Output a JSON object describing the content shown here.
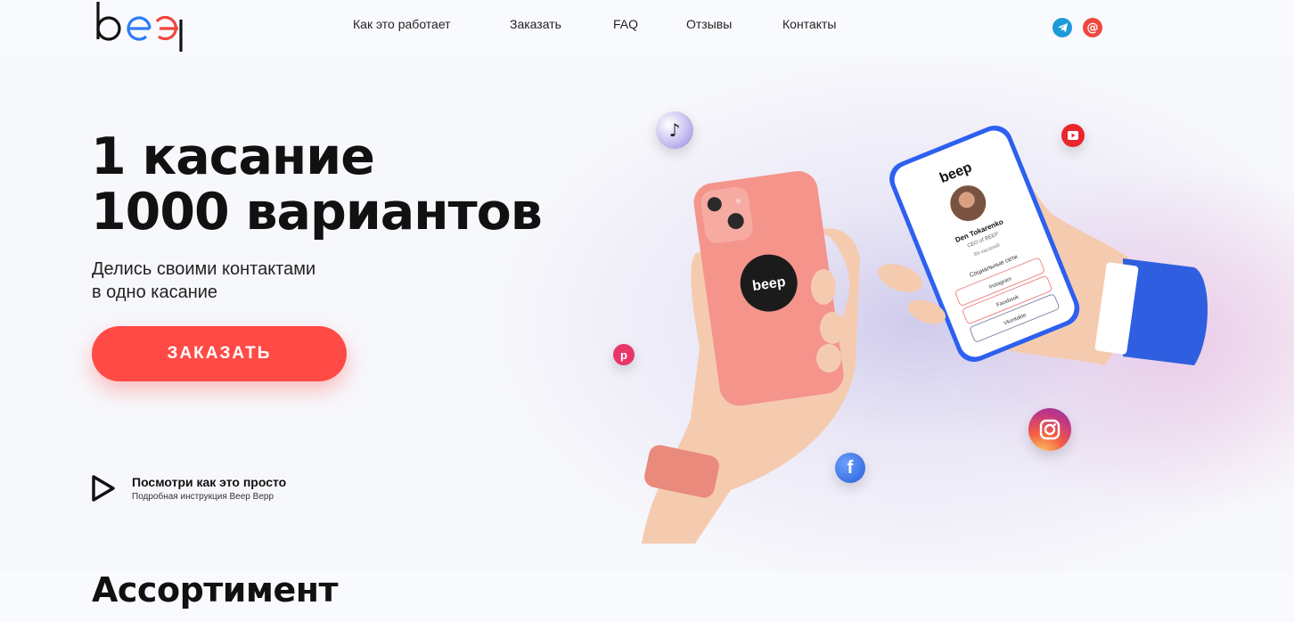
{
  "header": {
    "logo_text": "beep",
    "nav": [
      "Как это работает",
      "Заказать",
      "FAQ",
      "Отзывы",
      "Контакты"
    ],
    "social": [
      "telegram-icon",
      "email-icon"
    ]
  },
  "hero": {
    "title_line1": "1 касание",
    "title_line2": "1000 вариантов",
    "subtitle_line1": "Делись своими контактами",
    "subtitle_line2": "в одно касание",
    "order_button": "ЗАКАЗАТЬ",
    "video_title": "Посмотри как это просто",
    "video_subtitle": "Подробная инструкция Beep Bepp"
  },
  "phone_card": {
    "name": "Den Tokarenko",
    "role": "CEO of BEEP",
    "taps": "89 касаний",
    "section": "Социальные сети",
    "links": [
      "Instagram",
      "Facebook",
      "Vkontakte"
    ]
  },
  "assortment": {
    "title": "Ассортимент"
  },
  "colors": {
    "accent": "#ff4a46",
    "telegram": "#1d9bd8",
    "email": "#f0473f"
  }
}
